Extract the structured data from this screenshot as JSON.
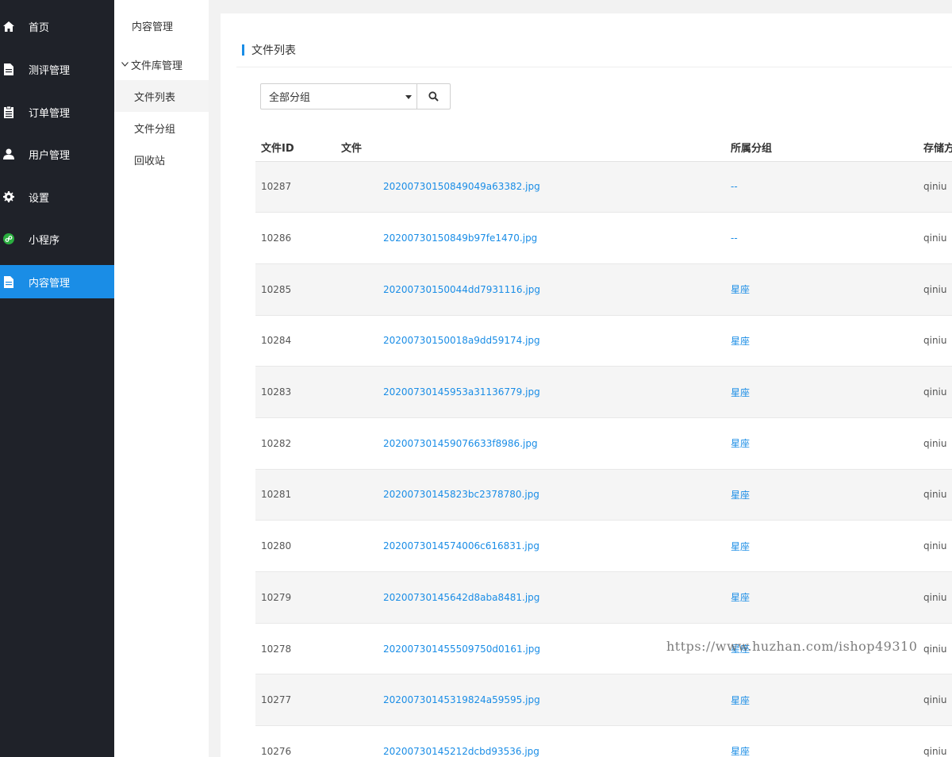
{
  "sidebar": {
    "items": [
      {
        "label": "首页",
        "icon": "home-icon"
      },
      {
        "label": "测评管理",
        "icon": "document-icon"
      },
      {
        "label": "订单管理",
        "icon": "clipboard-icon"
      },
      {
        "label": "用户管理",
        "icon": "user-icon"
      },
      {
        "label": "设置",
        "icon": "gear-icon"
      },
      {
        "label": "小程序",
        "icon": "mini-program-icon"
      },
      {
        "label": "内容管理",
        "icon": "document-icon",
        "active": true
      }
    ]
  },
  "subnav": {
    "title": "内容管理",
    "group": "文件库管理",
    "items": [
      {
        "label": "文件列表",
        "active": true
      },
      {
        "label": "文件分组"
      },
      {
        "label": "回收站"
      }
    ]
  },
  "main": {
    "title": "文件列表",
    "filter": {
      "selected": "全部分组"
    },
    "table": {
      "headers": [
        "文件ID",
        "文件",
        "所属分组",
        "存储方"
      ],
      "rows": [
        {
          "id": "10287",
          "file": "20200730150849049a63382.jpg",
          "group": "--",
          "storage": "qiniu"
        },
        {
          "id": "10286",
          "file": "20200730150849b97fe1470.jpg",
          "group": "--",
          "storage": "qiniu"
        },
        {
          "id": "10285",
          "file": "20200730150044dd7931116.jpg",
          "group": "星座",
          "storage": "qiniu"
        },
        {
          "id": "10284",
          "file": "20200730150018a9dd59174.jpg",
          "group": "星座",
          "storage": "qiniu"
        },
        {
          "id": "10283",
          "file": "20200730145953a31136779.jpg",
          "group": "星座",
          "storage": "qiniu"
        },
        {
          "id": "10282",
          "file": "202007301459076633f8986.jpg",
          "group": "星座",
          "storage": "qiniu"
        },
        {
          "id": "10281",
          "file": "20200730145823bc2378780.jpg",
          "group": "星座",
          "storage": "qiniu"
        },
        {
          "id": "10280",
          "file": "2020073014574006c616831.jpg",
          "group": "星座",
          "storage": "qiniu"
        },
        {
          "id": "10279",
          "file": "20200730145642d8aba8481.jpg",
          "group": "星座",
          "storage": "qiniu"
        },
        {
          "id": "10278",
          "file": "202007301455509750d0161.jpg",
          "group": "星座",
          "storage": "qiniu"
        },
        {
          "id": "10277",
          "file": "20200730145319824a59595.jpg",
          "group": "星座",
          "storage": "qiniu"
        },
        {
          "id": "10276",
          "file": "20200730145212dcbd93536.jpg",
          "group": "星座",
          "storage": "qiniu"
        }
      ]
    }
  },
  "watermark": "https://www.huzhan.com/ishop49310",
  "colors": {
    "accent": "#1a8de6",
    "sidebar_bg": "#1f2229",
    "mini_program_green": "#2aae3f"
  }
}
